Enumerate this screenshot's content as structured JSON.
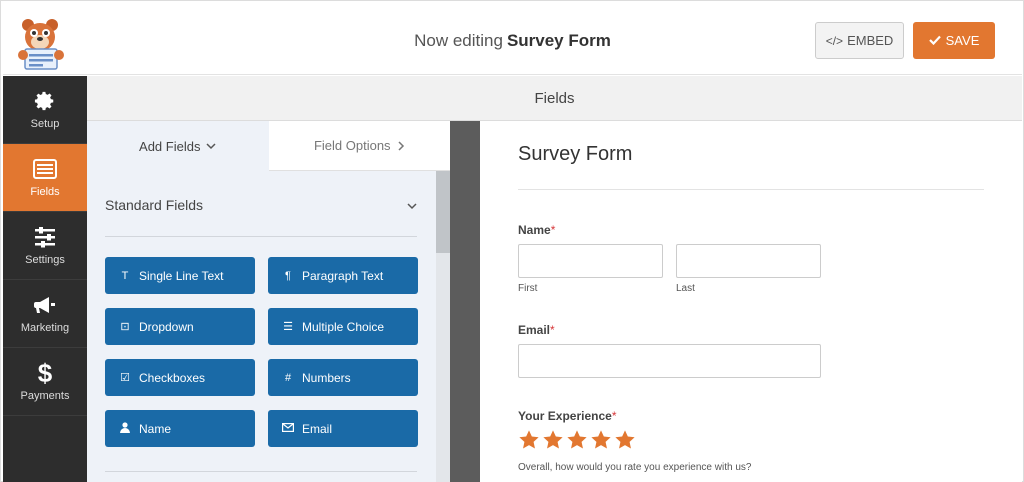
{
  "header": {
    "editing_prefix": "Now editing",
    "form_name": "Survey Form",
    "embed_label": "EMBED",
    "save_label": "SAVE",
    "accent_color": "#e27730"
  },
  "sidebar": {
    "items": [
      {
        "label": "Setup",
        "icon": "gear-icon"
      },
      {
        "label": "Fields",
        "icon": "list-icon",
        "active": true
      },
      {
        "label": "Settings",
        "icon": "sliders-icon"
      },
      {
        "label": "Marketing",
        "icon": "megaphone-icon"
      },
      {
        "label": "Payments",
        "icon": "dollar-icon"
      }
    ]
  },
  "section_title": "Fields",
  "panel": {
    "tabs": [
      {
        "label": "Add Fields",
        "icon": "chevron-down-icon"
      },
      {
        "label": "Field Options",
        "icon": "chevron-right-icon"
      }
    ],
    "group_title": "Standard Fields",
    "buttons": [
      {
        "label": "Single Line Text",
        "icon": "text-icon"
      },
      {
        "label": "Paragraph Text",
        "icon": "paragraph-icon"
      },
      {
        "label": "Dropdown",
        "icon": "dropdown-icon"
      },
      {
        "label": "Multiple Choice",
        "icon": "list-bullets-icon"
      },
      {
        "label": "Checkboxes",
        "icon": "checkbox-icon"
      },
      {
        "label": "Numbers",
        "icon": "hash-icon"
      },
      {
        "label": "Name",
        "icon": "user-icon"
      },
      {
        "label": "Email",
        "icon": "envelope-icon"
      }
    ],
    "button_color": "#1a6aa7"
  },
  "preview": {
    "title": "Survey Form",
    "name_label": "Name",
    "first_label": "First",
    "last_label": "Last",
    "email_label": "Email",
    "experience_label": "Your Experience",
    "required_mark": "*",
    "rating_stars": 5,
    "star_color": "#e27730",
    "experience_desc": "Overall, how would you rate you experience with us?"
  }
}
